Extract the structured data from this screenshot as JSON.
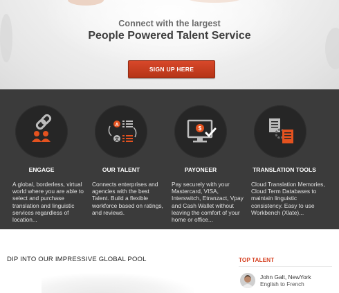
{
  "hero": {
    "subtitle": "Connect with the largest",
    "title": "People Powered Talent Service",
    "signup_label": "SIGN UP HERE"
  },
  "features": [
    {
      "title": "ENGAGE",
      "icon": "chain-people-icon",
      "desc": "A global, borderless, virtual world where you are able to select and purchase translation and linguistic services regardless of location..."
    },
    {
      "title": "OUR TALENT",
      "icon": "language-swap-icon",
      "desc": "Connects enterprises and agencies with the best Talent. Build a flexible workforce based on ratings, and reviews."
    },
    {
      "title": "PAYONEER",
      "icon": "payment-monitor-icon",
      "desc": "Pay securely with your Mastercard, VISA, Interswitch, Etranzact, Vpay and Cash Wallet without leaving the comfort of your home or office..."
    },
    {
      "title": "TRANSLATION TOOLS",
      "icon": "documents-gear-icon",
      "desc": "Cloud Translation Memories, Cloud Term Databases to maintain linguistic consistency. Easy to use Workbench (Xlate)..."
    }
  ],
  "pool": {
    "title": "DIP INTO OUR IMPRESSIVE GLOBAL POOL"
  },
  "top_talent": {
    "heading": "TOP TALENT",
    "items": [
      {
        "name": "John Galt, NewYork",
        "languages": "English to French"
      }
    ]
  },
  "colors": {
    "accent": "#d64324",
    "button": "#c73d1f",
    "band": "#3b3b3b",
    "circle": "#262626"
  }
}
